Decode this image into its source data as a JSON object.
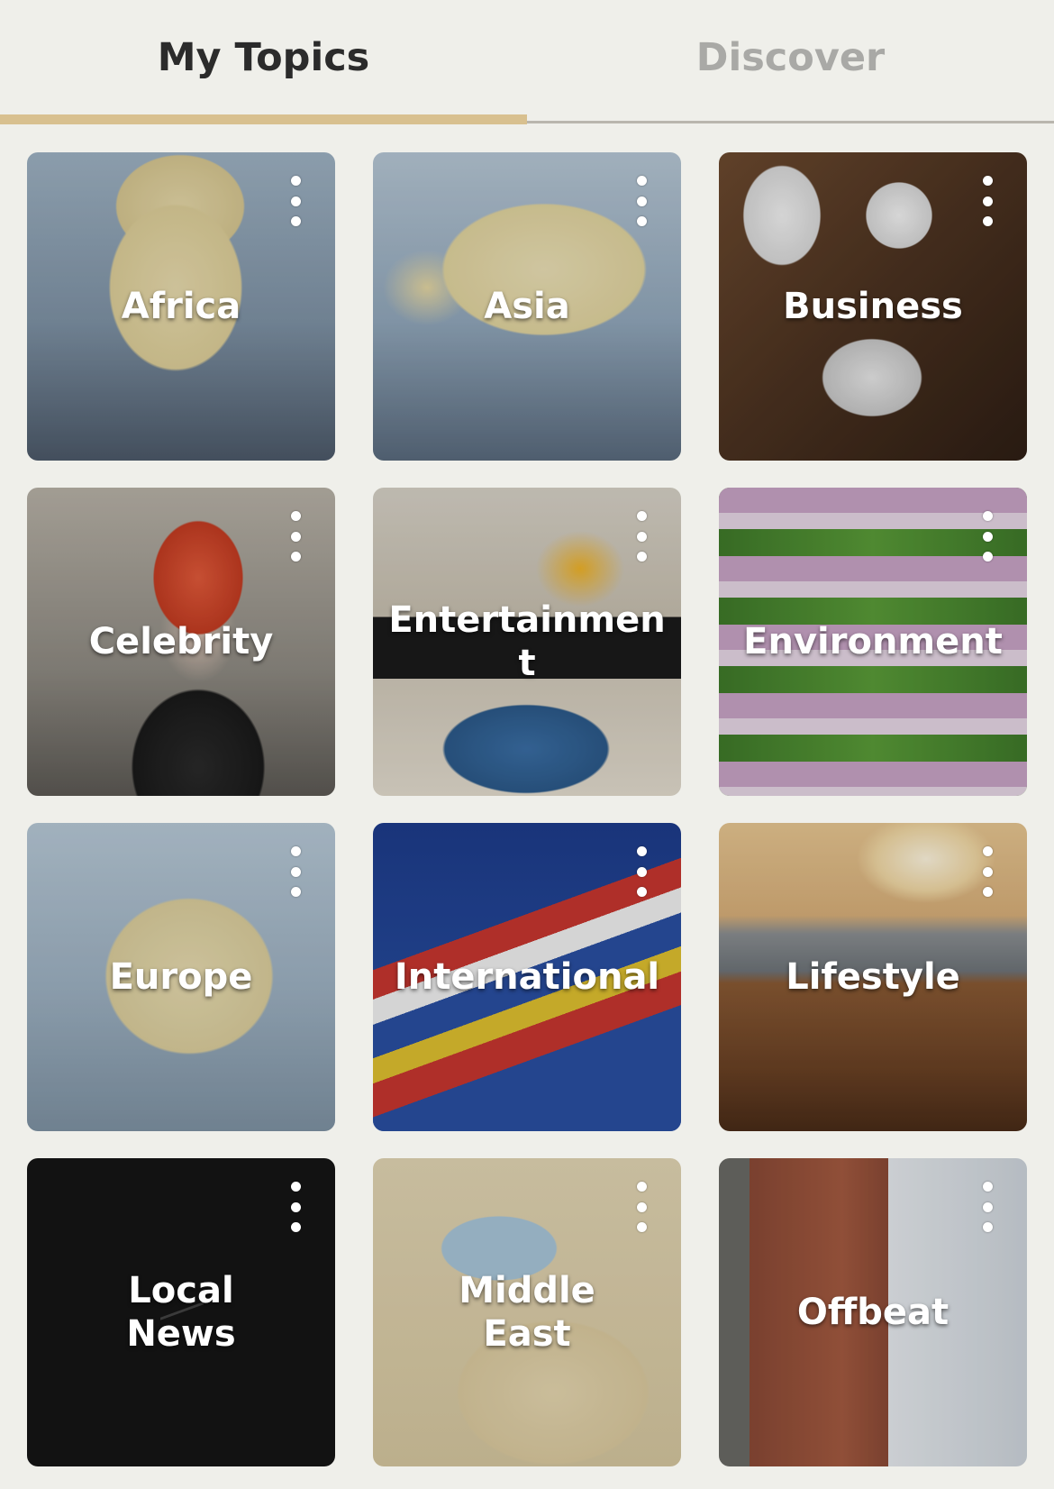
{
  "tabs": {
    "my_topics": "My Topics",
    "discover": "Discover",
    "selected": "my_topics"
  },
  "colors": {
    "background": "#efefea",
    "tab_indicator": "#d8c08f",
    "tab_active_text": "#2b2b2b",
    "tab_inactive_text": "#a9a9a6"
  },
  "topics": [
    {
      "title": "Africa",
      "icon": "more-vertical-icon"
    },
    {
      "title": "Asia",
      "icon": "more-vertical-icon"
    },
    {
      "title": "Business",
      "icon": "more-vertical-icon"
    },
    {
      "title": "Celebrity",
      "icon": "more-vertical-icon"
    },
    {
      "title": "Entertainmen t",
      "icon": "more-vertical-icon"
    },
    {
      "title": "Environment",
      "icon": "more-vertical-icon"
    },
    {
      "title": "Europe",
      "icon": "more-vertical-icon"
    },
    {
      "title": "International",
      "icon": "more-vertical-icon"
    },
    {
      "title": "Lifestyle",
      "icon": "more-vertical-icon"
    },
    {
      "title": "Local News",
      "icon": "more-vertical-icon"
    },
    {
      "title": "Middle East",
      "icon": "more-vertical-icon"
    },
    {
      "title": "Offbeat",
      "icon": "more-vertical-icon"
    }
  ]
}
